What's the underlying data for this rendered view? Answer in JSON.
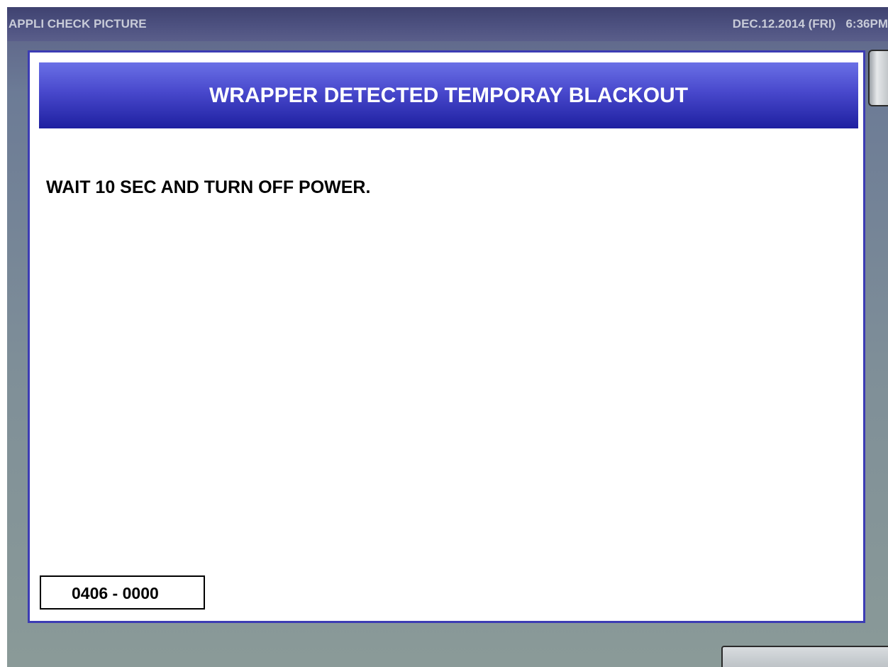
{
  "title_bar": {
    "app_title": "APPLI CHECK PICTURE",
    "datetime": "DEC.12.2014 (FRI)   6:36PM"
  },
  "dialog": {
    "title": "WRAPPER DETECTED TEMPORAY BLACKOUT",
    "message": "WAIT 10 SEC AND TURN OFF POWER.",
    "error_code": "0406 - 0000"
  },
  "colors": {
    "title_bar": "#4d5180",
    "dialog_border": "#3c3cb4",
    "dialog_header_top": "#6a70e6",
    "dialog_header_bottom": "#1e20a0",
    "screen_background": "#7f8f98"
  },
  "icons": {
    "scrollbar": "scrollbar-thumb",
    "bottom_button": "partially-visible-button"
  }
}
